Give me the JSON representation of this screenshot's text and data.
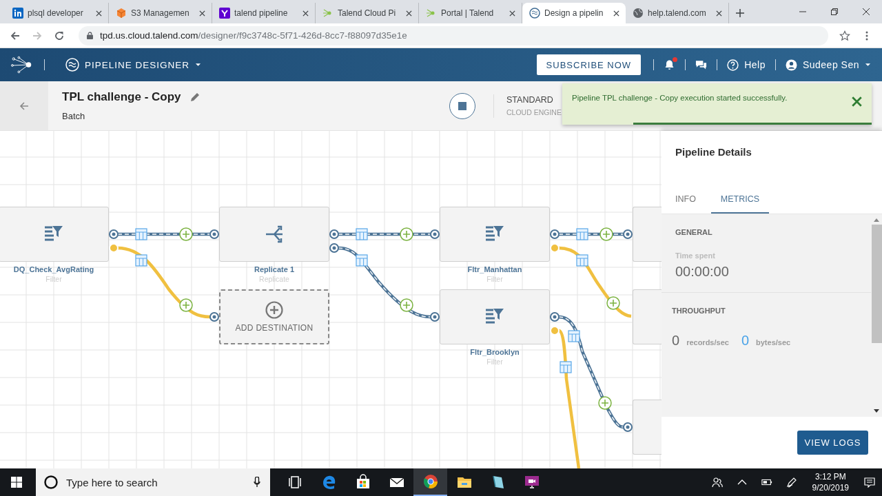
{
  "browser": {
    "tabs": [
      {
        "kind": "linkedin",
        "title": "plsql developer",
        "selected": false
      },
      {
        "kind": "cube",
        "title": "S3 Managemen",
        "selected": false
      },
      {
        "kind": "yahoo",
        "title": "talend pipeline",
        "selected": false
      },
      {
        "kind": "sprout",
        "title": "Talend Cloud Pi",
        "selected": false
      },
      {
        "kind": "sprout",
        "title": "Portal | Talend",
        "selected": false
      },
      {
        "kind": "waves",
        "title": "Design a pipelin",
        "selected": true
      },
      {
        "kind": "globe",
        "title": "help.talend.com",
        "selected": false
      }
    ],
    "url_host": "tpd.us.cloud.talend.com",
    "url_path": "/designer/f9c3748c-5f71-426d-8cc7-f88097d35e1e"
  },
  "app_header": {
    "product": "PIPELINE DESIGNER",
    "subscribe": "SUBSCRIBE NOW",
    "help": "Help",
    "user": "Sudeep Sen",
    "notification_dot": true
  },
  "pipeline": {
    "title": "TPL challenge - Copy",
    "mode": "Batch",
    "engine": "STANDARD",
    "engine_type": "CLOUD ENGINE"
  },
  "toast": {
    "message": "Pipeline TPL challenge - Copy execution started successfully.",
    "level": 0.77
  },
  "canvas": {
    "nodes": [
      {
        "name": "DQ_Check_AvgRating",
        "type": "Filter",
        "kind": "filter"
      },
      {
        "name": "Replicate 1",
        "type": "Replicate",
        "kind": "replicate"
      },
      {
        "name": "Fltr_Manhattan",
        "type": "Filter",
        "kind": "filter"
      },
      {
        "name": "Fltr_Brooklyn",
        "type": "Filter",
        "kind": "filter"
      }
    ],
    "add_destination": "ADD DESTINATION"
  },
  "details_panel": {
    "title": "Pipeline Details",
    "tabs": [
      {
        "label": "INFO",
        "selected": false
      },
      {
        "label": "METRICS",
        "selected": true
      }
    ],
    "general": "GENERAL",
    "time_label": "Time spent",
    "time_value": "00:00:00",
    "throughput": "THROUGHPUT",
    "records_value": "0",
    "records_unit": "records/sec",
    "bytes_value": "0",
    "bytes_unit": "bytes/sec",
    "view_logs": "VIEW LOGS"
  },
  "taskbar": {
    "search_placeholder": "Type here to search",
    "apps": [
      {
        "kind": "task-view",
        "selected": false
      },
      {
        "kind": "edge",
        "selected": false
      },
      {
        "kind": "store",
        "selected": false
      },
      {
        "kind": "mail",
        "selected": false
      },
      {
        "kind": "chrome",
        "selected": true
      },
      {
        "kind": "folder",
        "selected": false
      },
      {
        "kind": "notebook",
        "selected": false
      },
      {
        "kind": "recorder",
        "selected": false
      }
    ],
    "time": "3:12 PM",
    "date": "9/20/2019"
  }
}
